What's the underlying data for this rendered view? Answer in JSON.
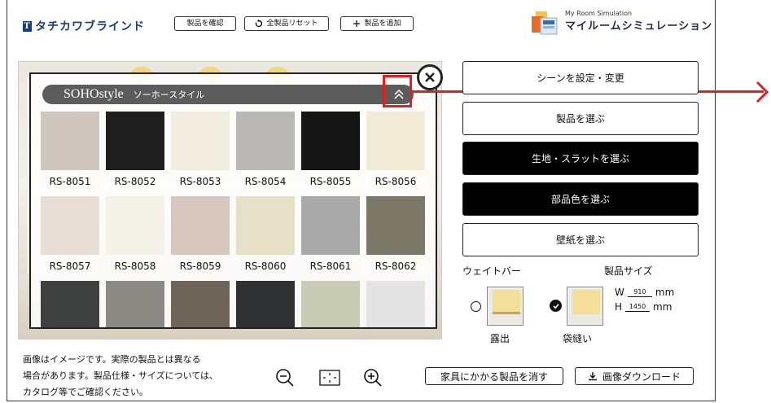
{
  "brand": {
    "mark": "T",
    "name": "タチカワブラインド"
  },
  "toolbar": {
    "confirm_label": "製品を確認",
    "reset_label": "全製品リセット",
    "add_label": "製品を追加"
  },
  "app": {
    "title_en": "My Room Simulation",
    "title_ja": "マイルームシミュレーション"
  },
  "series": {
    "name_en": "SOHOstyle",
    "name_ja": "ソーホースタイル"
  },
  "swatches": [
    {
      "code": "RS-8051",
      "color": "#cfc7bd"
    },
    {
      "code": "RS-8052",
      "color": "#1e1e1e"
    },
    {
      "code": "RS-8053",
      "color": "#f1eedf"
    },
    {
      "code": "RS-8054",
      "color": "#b9b8b6"
    },
    {
      "code": "RS-8055",
      "color": "#151515"
    },
    {
      "code": "RS-8056",
      "color": "#f1ebd8"
    },
    {
      "code": "RS-8057",
      "color": "#e8ded5"
    },
    {
      "code": "RS-8058",
      "color": "#f4f2e6"
    },
    {
      "code": "RS-8059",
      "color": "#d8c7bc"
    },
    {
      "code": "RS-8060",
      "color": "#e7e0c8"
    },
    {
      "code": "RS-8061",
      "color": "#a9a9a9"
    },
    {
      "code": "RS-8062",
      "color": "#7d7767"
    },
    {
      "code": "",
      "color": "#3f4140"
    },
    {
      "code": "",
      "color": "#8b8a85"
    },
    {
      "code": "",
      "color": "#6e6458"
    },
    {
      "code": "",
      "color": "#2f3132"
    },
    {
      "code": "",
      "color": "#c9ccb4"
    },
    {
      "code": "",
      "color": "#e4e4e4"
    }
  ],
  "side_menu": {
    "scene": "シーンを設定・変更",
    "product": "製品を選ぶ",
    "fabric": "生地・スラットを選ぶ",
    "parts": "部品色を選ぶ",
    "wallpaper": "壁紙を選ぶ"
  },
  "weight_bar": {
    "label": "ウェイトバー",
    "option1": "露出",
    "option2": "袋縫い",
    "selected": "袋縫い"
  },
  "size": {
    "label": "製品サイズ",
    "w_label": "W",
    "w_value": "910",
    "w_unit": "mm",
    "h_label": "H",
    "h_value": "1450",
    "h_unit": "mm"
  },
  "disclaimer": {
    "line1": "画像はイメージです。実際の製品とは異なる",
    "line2": "場合があります。製品仕様・サイズについては、",
    "line3": "カタログ等でご確認ください。"
  },
  "bottom": {
    "remove_label": "家具にかかる製品を消す",
    "download_label": "画像ダウンロード"
  },
  "colors": {
    "accent_red": "#e02020",
    "dark": "#000000",
    "series_bar": "#5c5c5c"
  }
}
